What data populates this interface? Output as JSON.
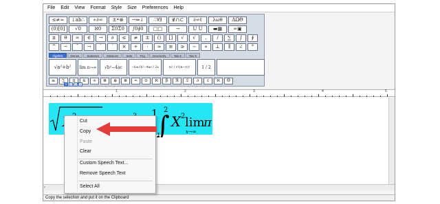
{
  "menubar": [
    "File",
    "Edit",
    "View",
    "Format",
    "Style",
    "Size",
    "Preferences",
    "Help"
  ],
  "palette": {
    "row1": [
      "≤≠≈",
      "↓ab∴",
      "∗∂∞",
      "±•⊗",
      "→⇔↓",
      "∴∀∃",
      "∉∩⊂",
      "∂∞ℓ",
      "λωθ",
      "ΔΩΘ"
    ],
    "row2": [
      "(0)[0]",
      "√0",
      "ℵ0",
      "Σ0Σ0",
      "∫0∮0",
      "□□",
      "→",
      "Ū Ü",
      "▬▦",
      "∞▣"
    ],
    "row3": [
      "π",
      "θ",
      "∞",
      "∈",
      "→",
      "∂",
      "≤",
      "≠",
      "±",
      "()",
      "[]",
      "√",
      "√ ",
      ". ",
      "/",
      "∑",
      "∫",
      "∮"
    ],
    "tabs": [
      "Algebra",
      "Derivs",
      "Statistics",
      "Matrices",
      "Sets",
      "Trig",
      "Geometry",
      "Tab 8",
      "Tab 9"
    ],
    "templates": [
      "√a²+b²",
      "lim n→∞",
      "√b²−4ac",
      "−b±√b²−4ac / 2a",
      "n! / r!(n−r)!",
      "1 / 2"
    ],
    "row5": [
      "≡",
      "∑",
      "π",
      "∈",
      "∞",
      "⊗",
      "⊕",
      "⊗",
      "≈",
      "⊙",
      "ℵ",
      "β",
      "ℜ",
      "𝔏",
      "∂",
      "ε",
      "ℵ",
      "Θ"
    ],
    "zoom": [
      "1",
      "2",
      "3",
      "4"
    ]
  },
  "ruler": {
    "numbers": [
      "1",
      "2",
      "3",
      "4",
      "5"
    ]
  },
  "equation": {
    "part1": "X",
    "sup1": "2",
    "x3": "X",
    "sup3": "3",
    "frac_num": "1",
    "int_upper": "2",
    "int_lower": "1",
    "lim_text": "lim",
    "pi": "π",
    "lim_sub": "x→∞"
  },
  "context_menu": {
    "items": [
      {
        "label": "Cut",
        "enabled": true
      },
      {
        "label": "Copy",
        "enabled": true
      },
      {
        "label": "Paste",
        "enabled": false
      },
      {
        "label": "Clear",
        "enabled": true
      },
      {
        "label": "Custom Speech Text...",
        "enabled": true
      },
      {
        "label": "Remove Speech Text",
        "enabled": true
      },
      {
        "label": "Select All",
        "enabled": true
      }
    ]
  },
  "status": "Copy the selection and put it on the Clipboard",
  "colors": {
    "selection": "#26e6f5",
    "arrow": "#e53b3b",
    "accent": "#3a6fd0"
  }
}
